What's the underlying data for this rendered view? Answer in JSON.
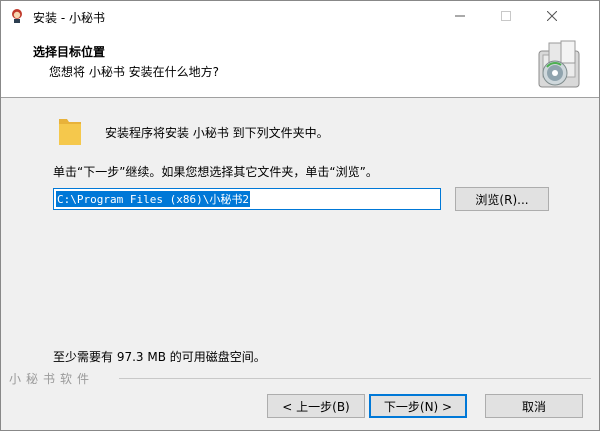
{
  "window": {
    "title": "安装 - 小秘书"
  },
  "header": {
    "title": "选择目标位置",
    "subtitle": "您想将 小秘书 安装在什么地方?"
  },
  "body": {
    "intro": "安装程序将安装 小秘书 到下列文件夹中。",
    "instruction": "单击“下一步”继续。如果您想选择其它文件夹，单击“浏览”。",
    "path_value": "C:\\Program Files (x86)\\小秘书2",
    "browse_label": "浏览(R)...",
    "space_required": "至少需要有 97.3 MB 的可用磁盘空间。"
  },
  "footer": {
    "brand": "小秘书软件",
    "back_label": "< 上一步(B)",
    "next_label": "下一步(N) >",
    "cancel_label": "取消"
  },
  "colors": {
    "accent": "#0078d7",
    "folder": "#f5c84c"
  },
  "icons": {
    "app": "app-logo-icon",
    "folder": "folder-icon",
    "header_graphic": "installer-disk-icon"
  }
}
